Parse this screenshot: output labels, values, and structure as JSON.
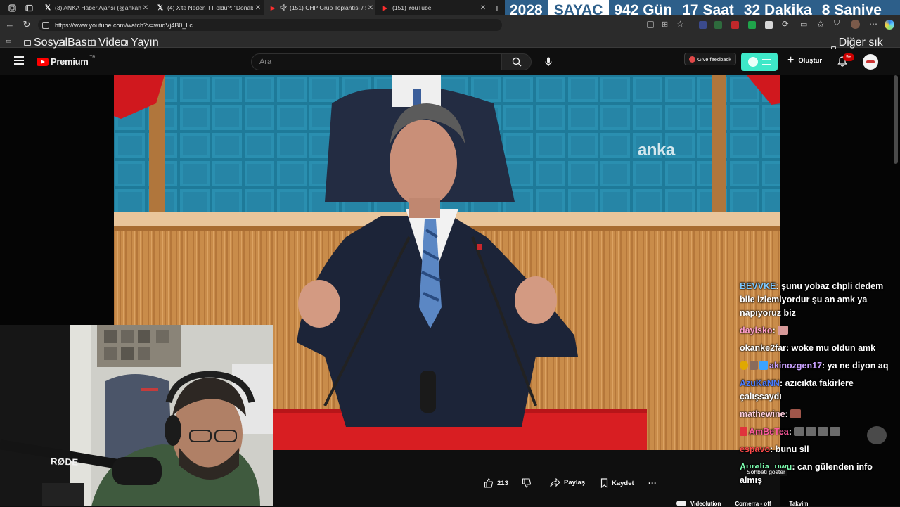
{
  "browser": {
    "tabs": [
      {
        "favicon": "x-logo",
        "title": "(3) ANKA Haber Ajansı (@ankaha"
      },
      {
        "favicon": "x-logo",
        "title": "(4) X'te Neden TT oldu?: \"Donald"
      },
      {
        "favicon": "youtube-logo",
        "title": "(151) CHP Grup Toplantısı / !",
        "muted": true
      },
      {
        "favicon": "youtube-logo",
        "title": "(151) YouTube"
      }
    ],
    "new_tab_label": "+",
    "url": "https://www.youtube.com/watch?v=wuqVj4B0_Lc",
    "bookmarks": [
      "Sosyal",
      "Basın",
      "Video",
      "Yayın"
    ],
    "other_bookmarks": "Diğer sık kullanılanlar"
  },
  "counter": {
    "year": "2028",
    "label": "SAYAÇ",
    "days": "942 Gün",
    "hours": "17 Saat",
    "minutes": "32 Dakika",
    "seconds": "8 Saniye",
    "bg_color": "#2d5f8a"
  },
  "youtube": {
    "logo_text": "Premium",
    "logo_region": "TR",
    "search_placeholder": "Ara",
    "feedback_label": "Give feedback",
    "create_label": "Oluştur",
    "notification_count": "9+",
    "video_watermark": "anka",
    "actions": {
      "like_count": "213",
      "share_label": "Paylaş",
      "save_label": "Kaydet",
      "more_label": "···"
    },
    "partial_bottom": [
      "Videolution",
      "Cornerra - off",
      "Takvim"
    ]
  },
  "overlay": {
    "mic_brand": "RØDE",
    "show_chat_label": "Sohbeti göster"
  },
  "chat": [
    {
      "user": "BEVVKE",
      "color": "#7ec8ff",
      "emotes": 0,
      "text": "şunu yobaz chpli dedem bile izlemiyordur şu an amk ya napıyoruz biz"
    },
    {
      "user": "dayisko",
      "color": "#ff9ecb",
      "emotes": 1,
      "text": ""
    },
    {
      "user": "okanke2far",
      "color": "#ffffff",
      "emotes": 0,
      "text": "woke mu oldun amk"
    },
    {
      "user": "akinozgen17",
      "color": "#c9a0ff",
      "badges": 3,
      "emotes": 0,
      "text": "ya ne diyon aq"
    },
    {
      "user": "AzuKaNN",
      "color": "#4a7cff",
      "emotes": 0,
      "text": "azıcıkta fakirlere çalışsaydı"
    },
    {
      "user": "mathewine",
      "color": "#ffd0e0",
      "emotes": 1,
      "text": ""
    },
    {
      "user": "AmBeTea",
      "color": "#ff5a9e",
      "badges": 1,
      "emotes": 4,
      "text": ""
    },
    {
      "user": "espavo",
      "color": "#ff4a4a",
      "emotes": 0,
      "text": "bunu sil"
    },
    {
      "user": "Aurelia_uwu",
      "color": "#7dffb0",
      "emotes": 0,
      "text": "can gülenden info almış"
    }
  ]
}
